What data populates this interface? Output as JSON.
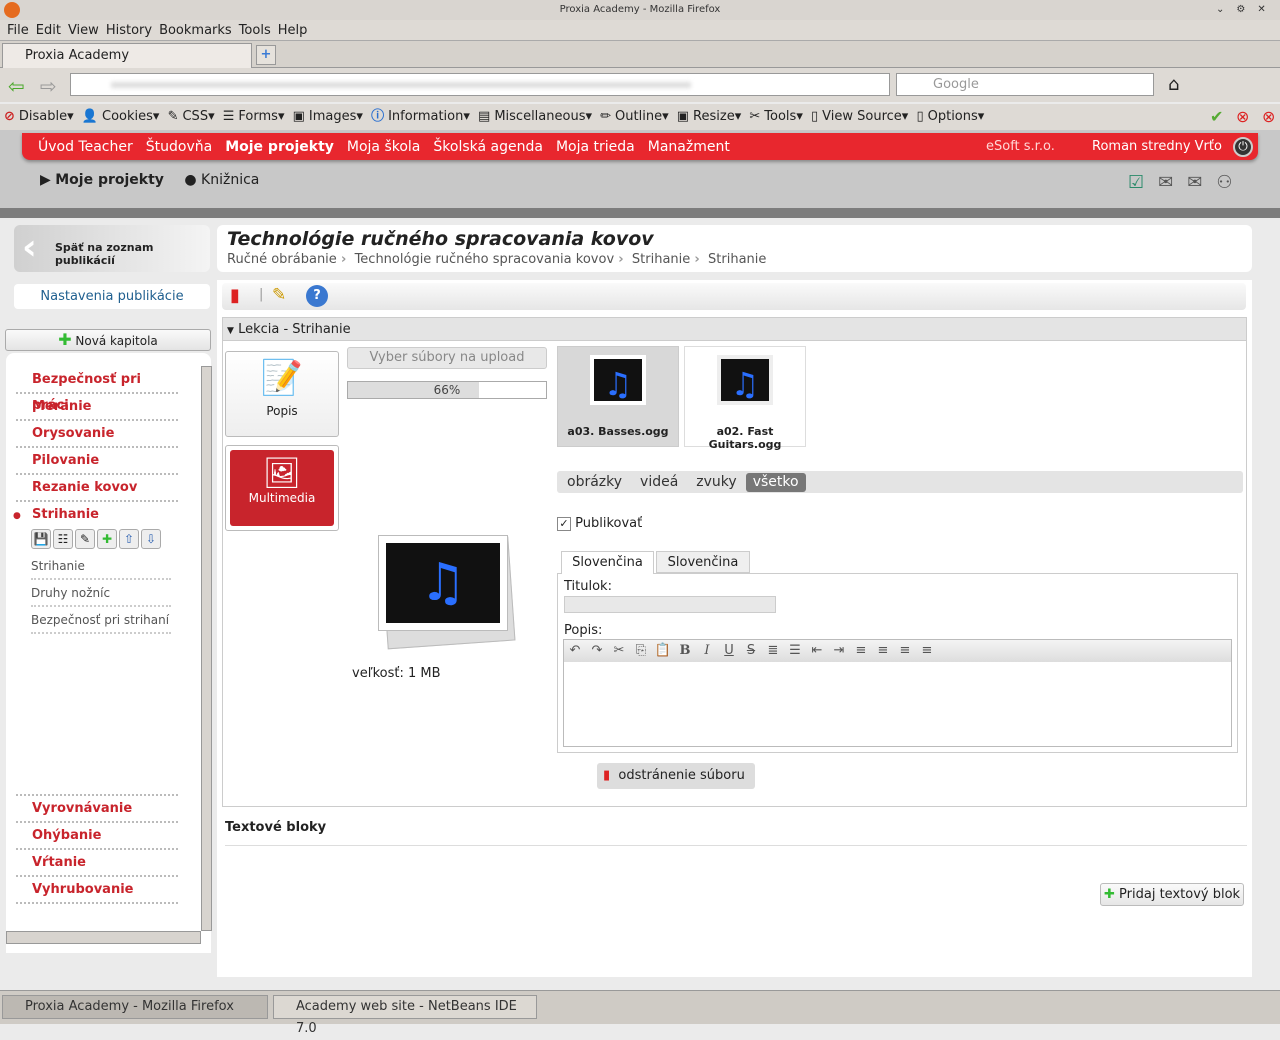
{
  "window": {
    "title": "Proxia Academy - Mozilla Firefox"
  },
  "menu": [
    "File",
    "Edit",
    "View",
    "History",
    "Bookmarks",
    "Tools",
    "Help"
  ],
  "browser_tab": "Proxia Academy",
  "search_placeholder": "Google",
  "devbar": [
    "Disable",
    "Cookies",
    "CSS",
    "Forms",
    "Images",
    "Information",
    "Miscellaneous",
    "Outline",
    "Resize",
    "Tools",
    "View Source",
    "Options"
  ],
  "nav": {
    "items": [
      "Úvod Teacher",
      "Študovňa",
      "Moje projekty",
      "Moja škola",
      "Školská agenda",
      "Moja trieda",
      "Manažment"
    ],
    "active": "Moje projekty",
    "company": "eSoft s.r.o.",
    "user": "Roman stredny Vrťo"
  },
  "subnav": {
    "current": "Moje projekty",
    "library": "Knižnica"
  },
  "sidebar": {
    "back": "Späť na zoznam publikácií",
    "settings": "Nastavenia publikácie",
    "new_chapter": "Nová kapitola",
    "chapters_top": [
      "Bezpečnosť pri práci",
      "Meranie",
      "Orysovanie",
      "Pilovanie",
      "Rezanie kovov"
    ],
    "active_chapter": "Strihanie",
    "lessons": [
      "Strihanie",
      "Druhy nožníc",
      "Bezpečnosť pri strihaní"
    ],
    "chapters_bottom": [
      "Vyrovnávanie",
      "Ohýbanie",
      "Vŕtanie",
      "Vyhrubovanie"
    ]
  },
  "main": {
    "title": "Technológie ručného spracovania kovov",
    "breadcrumb": [
      "Ručné obrábanie",
      "Technológie ručného spracovania kovov",
      "Strihanie",
      "Strihanie"
    ],
    "section": "Lekcia - Strihanie",
    "tile_popis": "Popis",
    "tile_multimedia": "Multimedia",
    "upload_button": "Vyber súbory na upload",
    "progress_percent": 66,
    "progress_label": "66%",
    "files": [
      "a03. Basses.ogg",
      "a02. Fast Guitars.ogg"
    ],
    "filters": [
      "obrázky",
      "videá",
      "zvuky",
      "všetko"
    ],
    "active_filter": "všetko",
    "publish_label": "Publikovať",
    "publish_checked": true,
    "lang_tabs": [
      "Slovenčina",
      "Slovenčina"
    ],
    "caption_label": "Titulok:",
    "desc_label": "Popis:",
    "size_label": "veľkosť: 1 MB",
    "remove_file": "odstránenie súboru",
    "text_blocks": "Textové bloky",
    "add_text_block": "Pridaj textový blok"
  },
  "taskbar": [
    "Proxia Academy - Mozilla Firefox",
    "Academy web site - NetBeans IDE 7.0"
  ],
  "colors": {
    "brand_red": "#e8272e",
    "chapter_red": "#c8242c"
  }
}
